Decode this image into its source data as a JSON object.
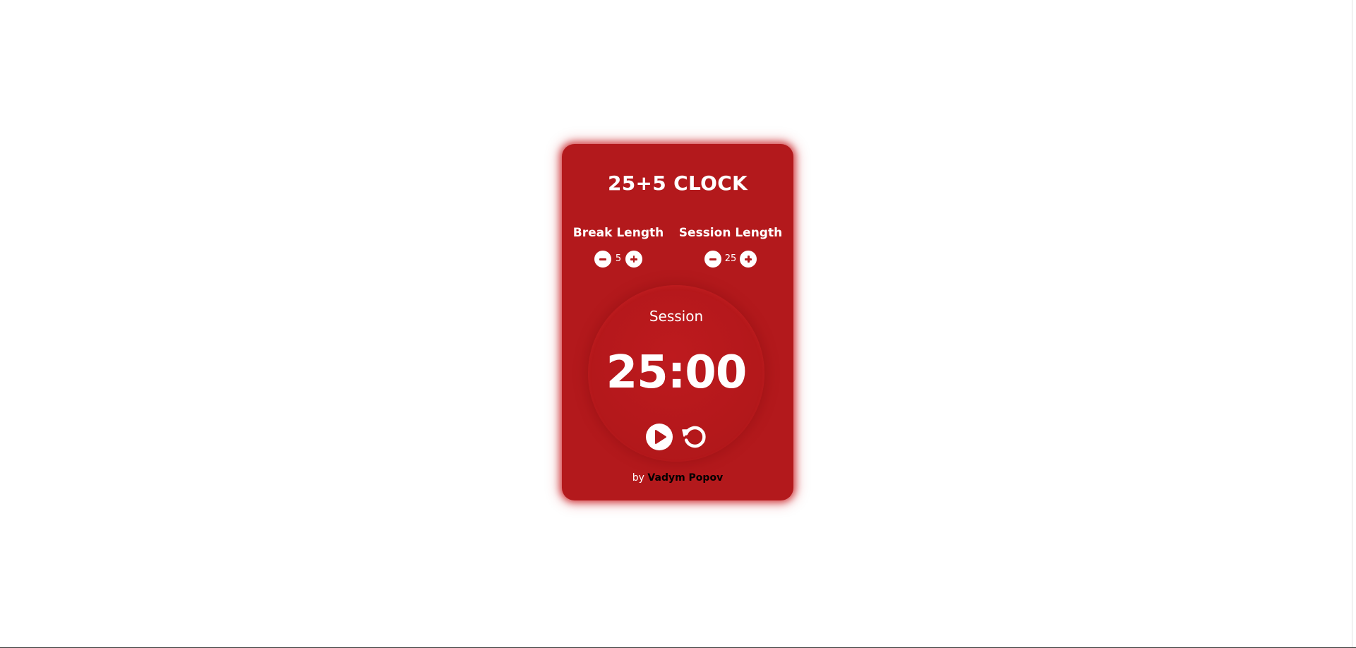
{
  "app": {
    "title": "25+5 CLOCK"
  },
  "break": {
    "label": "Break Length",
    "value": "5",
    "decrement_icon": "minus-icon",
    "increment_icon": "plus-icon"
  },
  "session": {
    "label": "Session Length",
    "value": "25",
    "decrement_icon": "minus-icon",
    "increment_icon": "plus-icon"
  },
  "timer": {
    "label": "Session",
    "time_left": "25:00",
    "start_icon": "play-icon",
    "reset_icon": "reset-icon"
  },
  "footer": {
    "by": "by",
    "author": "Vadym Popov"
  },
  "colors": {
    "card_background": "#b3191c",
    "text": "#ffffff",
    "author_text": "#000000",
    "page_background": "#ffffff"
  }
}
